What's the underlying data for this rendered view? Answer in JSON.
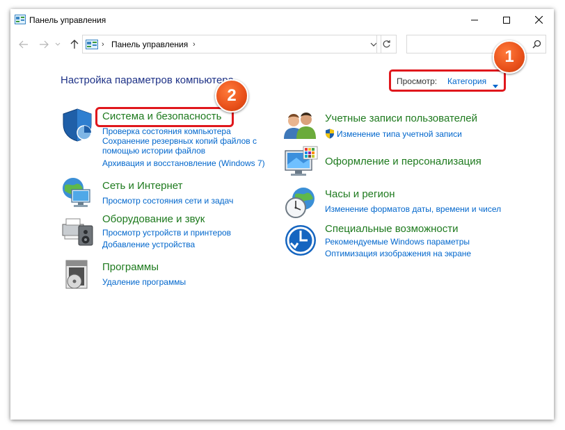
{
  "window": {
    "title": "Панель управления"
  },
  "address_bar": {
    "path_label": "Панель управления",
    "separator": "›"
  },
  "search": {
    "value": "",
    "placeholder": ""
  },
  "content": {
    "heading": "Настройка параметров компьютера",
    "view_by_label": "Просмотр:",
    "view_by_value": "Категория"
  },
  "badges": [
    "1",
    "2"
  ],
  "categories_left": [
    {
      "title": "Система и безопасность",
      "icon": "shield-icon",
      "links": [
        "Проверка состояния компьютера",
        "Сохранение резервных копий файлов с",
        "помощью истории файлов",
        "Архивация и восстановление (Windows 7)"
      ]
    },
    {
      "title": "Сеть и Интернет",
      "icon": "network-globe-icon",
      "links": [
        "Просмотр состояния сети и задач"
      ]
    },
    {
      "title": "Оборудование и звук",
      "icon": "printer-speaker-icon",
      "links": [
        "Просмотр устройств и принтеров",
        "Добавление устройства"
      ]
    },
    {
      "title": "Программы",
      "icon": "programs-disc-icon",
      "links": [
        "Удаление программы"
      ]
    }
  ],
  "categories_right": [
    {
      "title": "Учетные записи пользователей",
      "icon": "users-icon",
      "links": [
        "Изменение типа учетной записи"
      ]
    },
    {
      "title": "Оформление и персонализация",
      "icon": "monitor-palette-icon",
      "links": []
    },
    {
      "title": "Часы и регион",
      "icon": "clock-globe-icon",
      "links": [
        "Изменение форматов даты, времени и чисел"
      ]
    },
    {
      "title": "Специальные возможности",
      "icon": "ease-of-access-icon",
      "links": [
        "Рекомендуемые Windows параметры",
        "Оптимизация изображения на экране"
      ]
    }
  ],
  "colors": {
    "heading": "#1e3287",
    "category_title": "#1e7a1e",
    "link": "#0066cc",
    "annotation": "#e0171c",
    "badge": "#e8501a"
  }
}
